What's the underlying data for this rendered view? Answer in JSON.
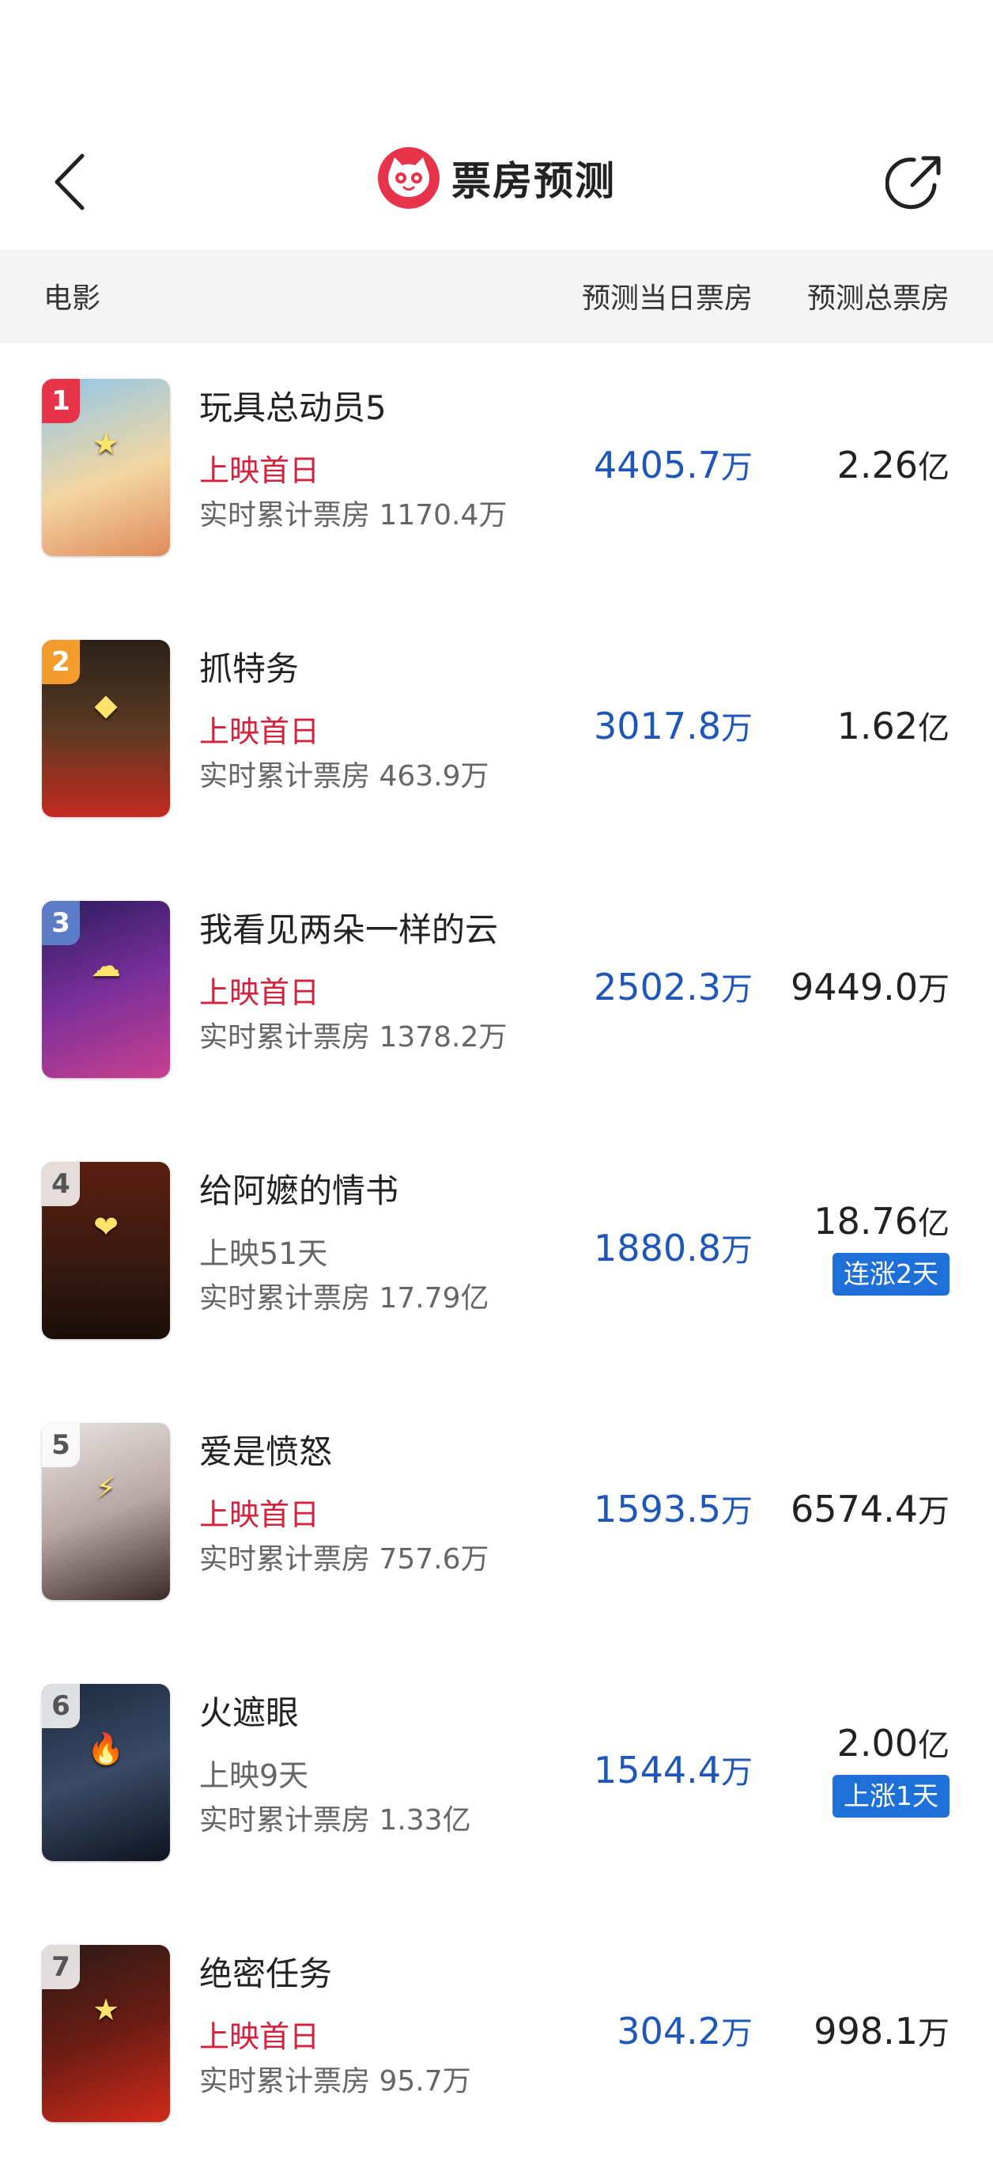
{
  "header": {
    "title": "票房预测",
    "back_icon": "chevron-left-icon",
    "logo_icon": "maoyan-cat-logo",
    "share_icon": "share-arrow-icon"
  },
  "columns": {
    "movie": "电影",
    "daily": "预测当日票房",
    "total": "预测总票房"
  },
  "colors": {
    "accent_blue": "#1f57b8",
    "badge_blue": "#1f6fd9",
    "first_day_red": "#d6213c",
    "logo_red": "#e8344a"
  },
  "movies": [
    {
      "rank": "1",
      "name": "玩具总动员5",
      "status": "上映首日",
      "cumulative": "实时累计票房 1170.4万",
      "daily_value": "4405.7",
      "daily_unit": "万",
      "total_value": "2.26",
      "total_unit": "亿",
      "badge": ""
    },
    {
      "rank": "2",
      "name": "抓特务",
      "status": "上映首日",
      "cumulative": "实时累计票房 463.9万",
      "daily_value": "3017.8",
      "daily_unit": "万",
      "total_value": "1.62",
      "total_unit": "亿",
      "badge": ""
    },
    {
      "rank": "3",
      "name": "我看见两朵一样的云",
      "status": "上映首日",
      "cumulative": "实时累计票房 1378.2万",
      "daily_value": "2502.3",
      "daily_unit": "万",
      "total_value": "9449.0",
      "total_unit": "万",
      "badge": ""
    },
    {
      "rank": "4",
      "name": "给阿嬷的情书",
      "status": "上映51天",
      "cumulative": "实时累计票房 17.79亿",
      "daily_value": "1880.8",
      "daily_unit": "万",
      "total_value": "18.76",
      "total_unit": "亿",
      "badge": "连涨2天"
    },
    {
      "rank": "5",
      "name": "爱是愤怒",
      "status": "上映首日",
      "cumulative": "实时累计票房 757.6万",
      "daily_value": "1593.5",
      "daily_unit": "万",
      "total_value": "6574.4",
      "total_unit": "万",
      "badge": ""
    },
    {
      "rank": "6",
      "name": "火遮眼",
      "status": "上映9天",
      "cumulative": "实时累计票房 1.33亿",
      "daily_value": "1544.4",
      "daily_unit": "万",
      "total_value": "2.00",
      "total_unit": "亿",
      "badge": "上涨1天"
    },
    {
      "rank": "7",
      "name": "绝密任务",
      "status": "上映首日",
      "cumulative": "实时累计票房 95.7万",
      "daily_value": "304.2",
      "daily_unit": "万",
      "total_value": "998.1",
      "total_unit": "万",
      "badge": ""
    }
  ]
}
